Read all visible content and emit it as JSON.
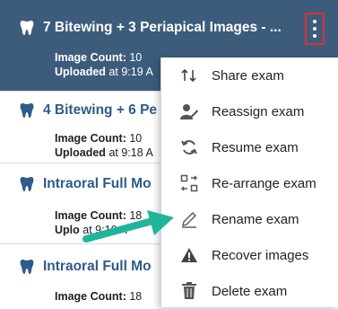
{
  "exams": [
    {
      "title": "7 Bitewing + 3 Periapical Images - ...",
      "count_label": "Image Count:",
      "count": "10",
      "uploaded_label": "Uploaded",
      "uploaded_at": "at 9:19 A"
    },
    {
      "title": "4 Bitewing + 6 Pe",
      "count_label": "Image Count:",
      "count": "10",
      "uploaded_label": "Uploaded",
      "uploaded_at": "at 9:18 A"
    },
    {
      "title": "Intraoral Full Mo",
      "count_label": "Image Count:",
      "count": "18",
      "uploaded_label": "Uplo",
      "uploaded_at": "at 9:16 A"
    },
    {
      "title": "Intraoral Full Mo",
      "count_label": "Image Count:",
      "count": "18"
    }
  ],
  "menu": {
    "items": [
      {
        "label": "Share exam",
        "icon": "share-icon"
      },
      {
        "label": "Reassign exam",
        "icon": "reassign-icon"
      },
      {
        "label": "Resume exam",
        "icon": "resume-icon"
      },
      {
        "label": "Re-arrange exam",
        "icon": "rearrange-icon"
      },
      {
        "label": "Rename exam",
        "icon": "rename-icon"
      },
      {
        "label": "Recover images",
        "icon": "warning-icon"
      },
      {
        "label": "Delete exam",
        "icon": "trash-icon"
      }
    ]
  },
  "colors": {
    "selected_bg": "#3d5c7c",
    "title_blue": "#2f5b8a",
    "highlight_border": "#d9303a",
    "arrow": "#1fb59a"
  }
}
